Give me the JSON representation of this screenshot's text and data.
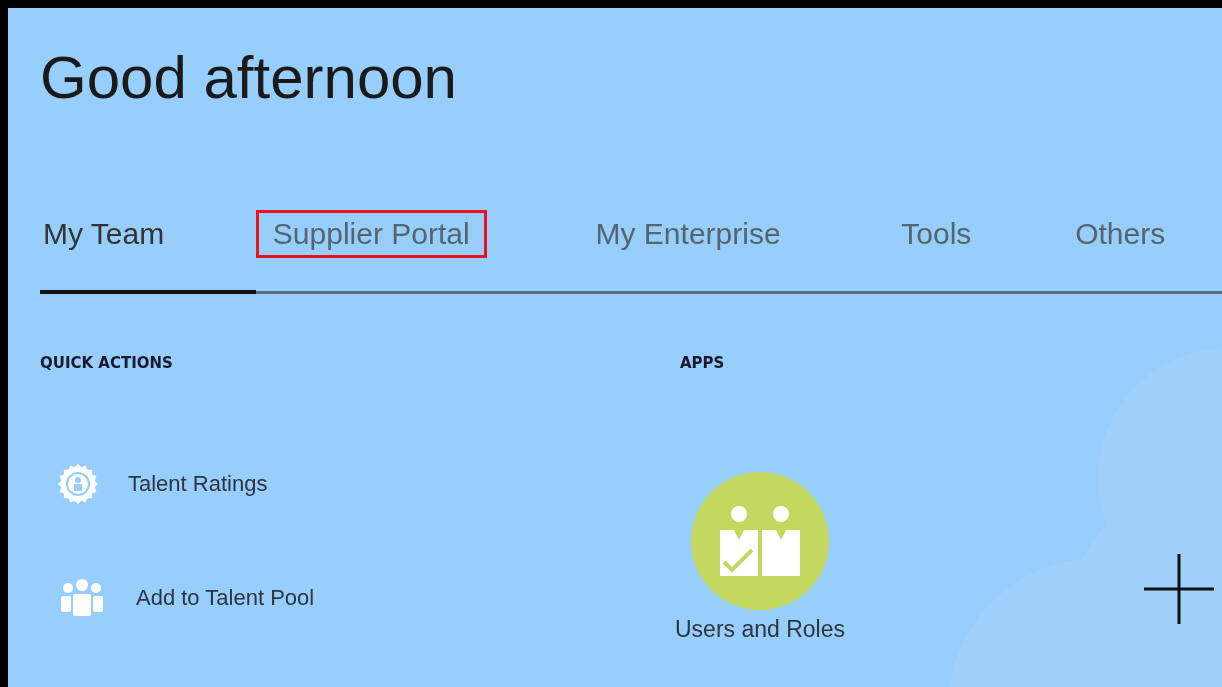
{
  "greeting": "Good afternoon",
  "tabs": [
    {
      "label": "My Team",
      "selected": true,
      "highlighted": false
    },
    {
      "label": "Supplier Portal",
      "selected": false,
      "highlighted": true
    },
    {
      "label": "My Enterprise",
      "selected": false,
      "highlighted": false
    },
    {
      "label": "Tools",
      "selected": false,
      "highlighted": false
    },
    {
      "label": "Others",
      "selected": false,
      "highlighted": false
    }
  ],
  "quick_actions": {
    "title": "QUICK ACTIONS",
    "items": [
      {
        "label": "Talent Ratings",
        "kind": "badge"
      },
      {
        "label": "Add to Talent Pool",
        "kind": "group"
      }
    ]
  },
  "apps": {
    "title": "APPS",
    "items": [
      {
        "label": "Users and Roles",
        "color": "#c4d75e"
      }
    ]
  }
}
